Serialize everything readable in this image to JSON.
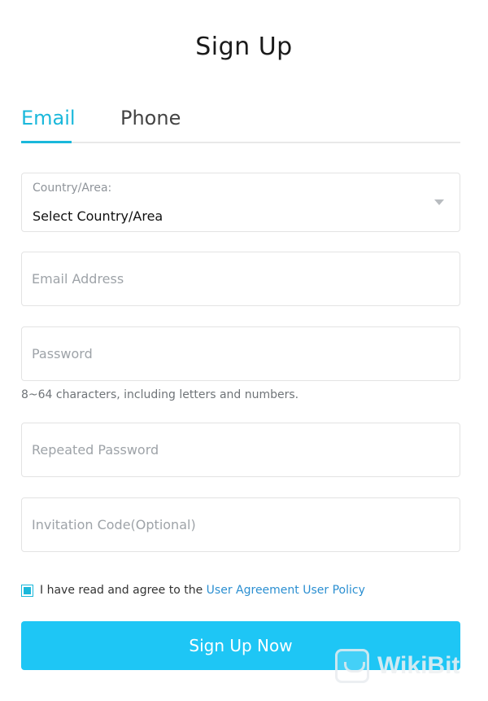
{
  "page": {
    "title": "Sign Up"
  },
  "tabs": [
    {
      "label": "Email",
      "active": true
    },
    {
      "label": "Phone",
      "active": false
    }
  ],
  "form": {
    "country": {
      "label": "Country/Area:",
      "value": "Select Country/Area"
    },
    "email": {
      "placeholder": "Email Address",
      "value": ""
    },
    "password": {
      "placeholder": "Password",
      "value": "",
      "hint": "8~64 characters, including letters and numbers."
    },
    "repeat_password": {
      "placeholder": "Repeated Password",
      "value": ""
    },
    "invitation_code": {
      "placeholder": "Invitation Code(Optional)",
      "value": ""
    }
  },
  "agreement": {
    "checked": true,
    "text": "I have read and agree to the",
    "link1": "User Agreement",
    "link2": "User Policy"
  },
  "submit": {
    "label": "Sign Up Now"
  },
  "watermark": {
    "text": "WikiBit"
  },
  "colors": {
    "accent": "#1ab8db",
    "button": "#1ec6f5",
    "link": "#2b8fd1"
  }
}
